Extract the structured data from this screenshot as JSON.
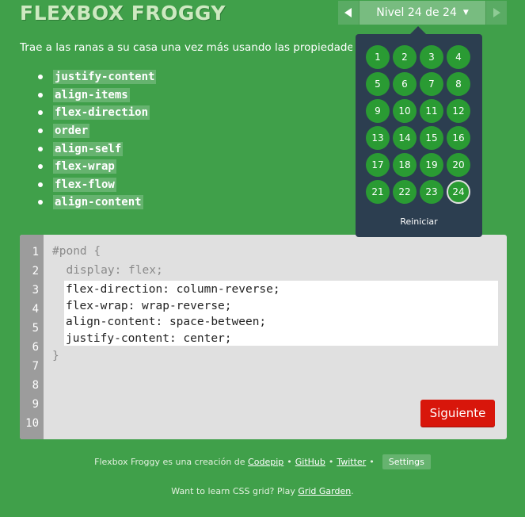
{
  "header": {
    "title": "FLEXBOX FROGGY",
    "level_label": "Nivel 24 de 24"
  },
  "intro": "Trae a las ranas a su casa una vez más usando las propiedades CSS",
  "properties": [
    "justify-content",
    "align-items",
    "flex-direction",
    "order",
    "align-self",
    "flex-wrap",
    "flex-flow",
    "align-content"
  ],
  "editor": {
    "line_numbers": [
      "1",
      "2",
      "3",
      "4",
      "5",
      "6",
      "7",
      "8",
      "9",
      "10"
    ],
    "line1": "#pond {",
    "line2": "  display: flex;",
    "input_value": "flex-direction: column-reverse;\nflex-wrap: wrap-reverse;\nalign-content: space-between;\njustify-content: center;",
    "close": "}",
    "next_label": "Siguiente"
  },
  "level_menu": {
    "levels": [
      "1",
      "2",
      "3",
      "4",
      "5",
      "6",
      "7",
      "8",
      "9",
      "10",
      "11",
      "12",
      "13",
      "14",
      "15",
      "16",
      "17",
      "18",
      "19",
      "20",
      "21",
      "22",
      "23",
      "24"
    ],
    "current": 24,
    "reset_label": "Reiniciar"
  },
  "footer": {
    "credit_text": "Flexbox Froggy es una creación de",
    "codepip": "Codepip",
    "github": "GitHub",
    "twitter": "Twitter",
    "settings": "Settings",
    "grid_text": "Want to learn CSS grid? Play",
    "grid_link": "Grid Garden",
    "period": "."
  },
  "colors": {
    "background": "#40a04a",
    "dropdown": "#2c3e50",
    "level_circle": "#2a9b33",
    "next_button": "#d8160b"
  }
}
